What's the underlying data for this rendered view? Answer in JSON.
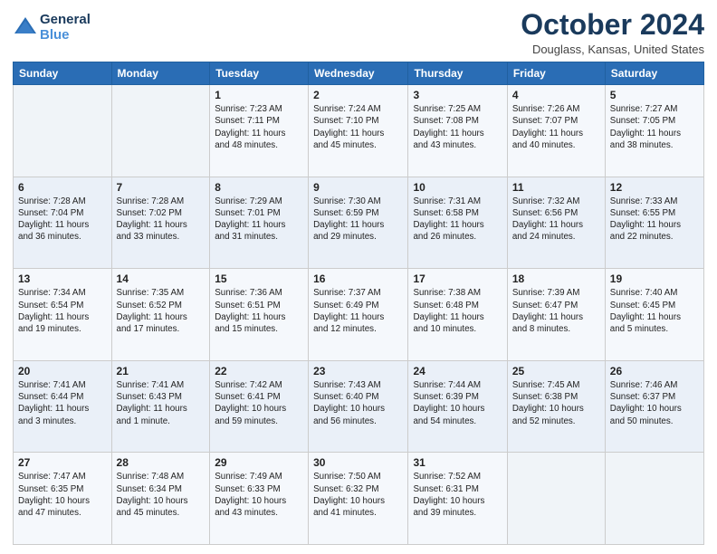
{
  "header": {
    "logo_line1": "General",
    "logo_line2": "Blue",
    "month": "October 2024",
    "location": "Douglass, Kansas, United States"
  },
  "days_of_week": [
    "Sunday",
    "Monday",
    "Tuesday",
    "Wednesday",
    "Thursday",
    "Friday",
    "Saturday"
  ],
  "weeks": [
    [
      {
        "day": "",
        "info": ""
      },
      {
        "day": "",
        "info": ""
      },
      {
        "day": "1",
        "info": "Sunrise: 7:23 AM\nSunset: 7:11 PM\nDaylight: 11 hours\nand 48 minutes."
      },
      {
        "day": "2",
        "info": "Sunrise: 7:24 AM\nSunset: 7:10 PM\nDaylight: 11 hours\nand 45 minutes."
      },
      {
        "day": "3",
        "info": "Sunrise: 7:25 AM\nSunset: 7:08 PM\nDaylight: 11 hours\nand 43 minutes."
      },
      {
        "day": "4",
        "info": "Sunrise: 7:26 AM\nSunset: 7:07 PM\nDaylight: 11 hours\nand 40 minutes."
      },
      {
        "day": "5",
        "info": "Sunrise: 7:27 AM\nSunset: 7:05 PM\nDaylight: 11 hours\nand 38 minutes."
      }
    ],
    [
      {
        "day": "6",
        "info": "Sunrise: 7:28 AM\nSunset: 7:04 PM\nDaylight: 11 hours\nand 36 minutes."
      },
      {
        "day": "7",
        "info": "Sunrise: 7:28 AM\nSunset: 7:02 PM\nDaylight: 11 hours\nand 33 minutes."
      },
      {
        "day": "8",
        "info": "Sunrise: 7:29 AM\nSunset: 7:01 PM\nDaylight: 11 hours\nand 31 minutes."
      },
      {
        "day": "9",
        "info": "Sunrise: 7:30 AM\nSunset: 6:59 PM\nDaylight: 11 hours\nand 29 minutes."
      },
      {
        "day": "10",
        "info": "Sunrise: 7:31 AM\nSunset: 6:58 PM\nDaylight: 11 hours\nand 26 minutes."
      },
      {
        "day": "11",
        "info": "Sunrise: 7:32 AM\nSunset: 6:56 PM\nDaylight: 11 hours\nand 24 minutes."
      },
      {
        "day": "12",
        "info": "Sunrise: 7:33 AM\nSunset: 6:55 PM\nDaylight: 11 hours\nand 22 minutes."
      }
    ],
    [
      {
        "day": "13",
        "info": "Sunrise: 7:34 AM\nSunset: 6:54 PM\nDaylight: 11 hours\nand 19 minutes."
      },
      {
        "day": "14",
        "info": "Sunrise: 7:35 AM\nSunset: 6:52 PM\nDaylight: 11 hours\nand 17 minutes."
      },
      {
        "day": "15",
        "info": "Sunrise: 7:36 AM\nSunset: 6:51 PM\nDaylight: 11 hours\nand 15 minutes."
      },
      {
        "day": "16",
        "info": "Sunrise: 7:37 AM\nSunset: 6:49 PM\nDaylight: 11 hours\nand 12 minutes."
      },
      {
        "day": "17",
        "info": "Sunrise: 7:38 AM\nSunset: 6:48 PM\nDaylight: 11 hours\nand 10 minutes."
      },
      {
        "day": "18",
        "info": "Sunrise: 7:39 AM\nSunset: 6:47 PM\nDaylight: 11 hours\nand 8 minutes."
      },
      {
        "day": "19",
        "info": "Sunrise: 7:40 AM\nSunset: 6:45 PM\nDaylight: 11 hours\nand 5 minutes."
      }
    ],
    [
      {
        "day": "20",
        "info": "Sunrise: 7:41 AM\nSunset: 6:44 PM\nDaylight: 11 hours\nand 3 minutes."
      },
      {
        "day": "21",
        "info": "Sunrise: 7:41 AM\nSunset: 6:43 PM\nDaylight: 11 hours\nand 1 minute."
      },
      {
        "day": "22",
        "info": "Sunrise: 7:42 AM\nSunset: 6:41 PM\nDaylight: 10 hours\nand 59 minutes."
      },
      {
        "day": "23",
        "info": "Sunrise: 7:43 AM\nSunset: 6:40 PM\nDaylight: 10 hours\nand 56 minutes."
      },
      {
        "day": "24",
        "info": "Sunrise: 7:44 AM\nSunset: 6:39 PM\nDaylight: 10 hours\nand 54 minutes."
      },
      {
        "day": "25",
        "info": "Sunrise: 7:45 AM\nSunset: 6:38 PM\nDaylight: 10 hours\nand 52 minutes."
      },
      {
        "day": "26",
        "info": "Sunrise: 7:46 AM\nSunset: 6:37 PM\nDaylight: 10 hours\nand 50 minutes."
      }
    ],
    [
      {
        "day": "27",
        "info": "Sunrise: 7:47 AM\nSunset: 6:35 PM\nDaylight: 10 hours\nand 47 minutes."
      },
      {
        "day": "28",
        "info": "Sunrise: 7:48 AM\nSunset: 6:34 PM\nDaylight: 10 hours\nand 45 minutes."
      },
      {
        "day": "29",
        "info": "Sunrise: 7:49 AM\nSunset: 6:33 PM\nDaylight: 10 hours\nand 43 minutes."
      },
      {
        "day": "30",
        "info": "Sunrise: 7:50 AM\nSunset: 6:32 PM\nDaylight: 10 hours\nand 41 minutes."
      },
      {
        "day": "31",
        "info": "Sunrise: 7:52 AM\nSunset: 6:31 PM\nDaylight: 10 hours\nand 39 minutes."
      },
      {
        "day": "",
        "info": ""
      },
      {
        "day": "",
        "info": ""
      }
    ]
  ]
}
